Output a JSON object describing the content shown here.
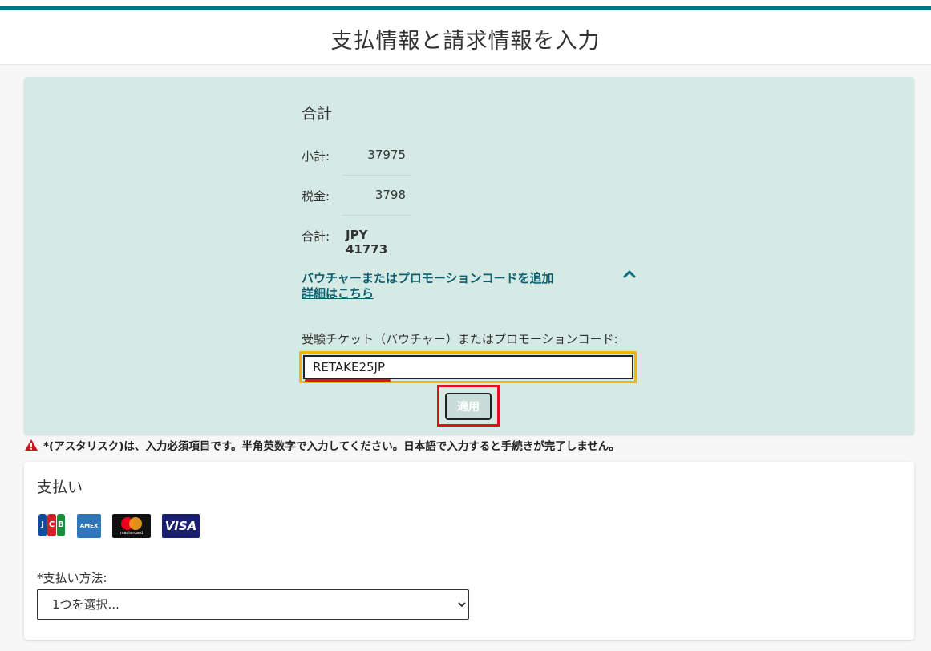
{
  "page": {
    "title": "支払情報と請求情報を入力"
  },
  "summary": {
    "heading": "合計",
    "subtotal": {
      "label": "小計:",
      "value": "37975"
    },
    "tax": {
      "label": "税金:",
      "value": "3798"
    },
    "total": {
      "label": "合計:",
      "value": "JPY 41773"
    }
  },
  "promo": {
    "toggle_label": "バウチャーまたはプロモーションコードを追加",
    "details_link": "詳細はこちら",
    "code_label": "受験チケット（バウチャー）またはプロモーションコード:",
    "code_value": "RETAKE25JP",
    "apply_label": "適用"
  },
  "required_note": "*(アスタリスク)は、入力必須項目です。半角英数字で入力してください。日本語で入力すると手続きが完了しません。",
  "payment": {
    "heading": "支払い",
    "card_logos": [
      {
        "icon": "jcb-logo-icon",
        "text": "JCB"
      },
      {
        "icon": "amex-logo-icon",
        "text": "AMEX"
      },
      {
        "icon": "mastercard-logo-icon",
        "text": "mastercard"
      },
      {
        "icon": "visa-logo-icon",
        "text": "VISA"
      }
    ],
    "method_label": "*支払い方法:",
    "method_selected": "1つを選択..."
  },
  "colors": {
    "accent_bar": "#0b7285",
    "panel_bg": "#d5eae4",
    "input_focus": "#f4b400",
    "highlight": "#e0101e",
    "link": "#0b5f6f"
  }
}
